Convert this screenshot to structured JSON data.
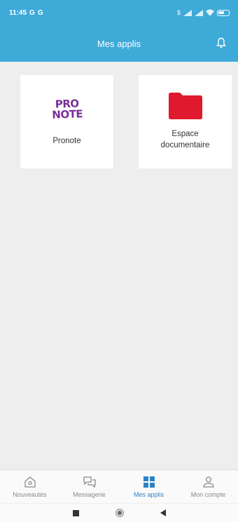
{
  "status_bar": {
    "time": "11:45",
    "notif_icons": [
      "G",
      "G"
    ],
    "right_text": "$",
    "battery_icon": "battery-icon"
  },
  "header": {
    "title": "Mes applis",
    "bell_icon": "bell-icon"
  },
  "apps": [
    {
      "logo_text_line1": "PRO",
      "logo_text_line2": "NOTE",
      "label": "Pronote",
      "logo_color": "#7a2e98"
    },
    {
      "label": "Espace documentaire",
      "icon": "folder-icon",
      "icon_color": "#e0192f"
    }
  ],
  "bottom_nav": [
    {
      "label": "Nouveautés",
      "icon": "home-icon",
      "active": false
    },
    {
      "label": "Messagerie",
      "icon": "chat-icon",
      "active": false
    },
    {
      "label": "Mes applis",
      "icon": "grid-icon",
      "active": true
    },
    {
      "label": "Mon compte",
      "icon": "user-icon",
      "active": false
    }
  ],
  "colors": {
    "primary": "#3eaad8",
    "active_nav": "#2a82c8",
    "background": "#eeeeef"
  }
}
